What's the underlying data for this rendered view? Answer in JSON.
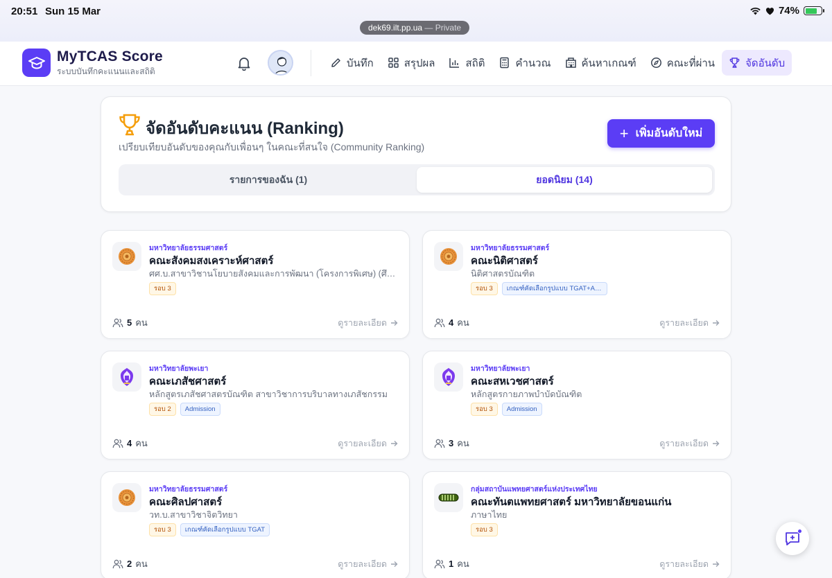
{
  "status_bar": {
    "time": "20:51",
    "date": "Sun 15 Mar",
    "battery": "74%",
    "battery_level": 0.74,
    "url": "dek69.ilt.pp.ua",
    "url_suffix": " — Private"
  },
  "header": {
    "brand": "MyTCAS Score",
    "tagline": "ระบบบันทึกคะแนนและสถิติ",
    "nav": [
      {
        "label": "บันทึก",
        "icon": "pen-icon"
      },
      {
        "label": "สรุปผล",
        "icon": "grid-icon"
      },
      {
        "label": "สถิติ",
        "icon": "bar-chart-icon"
      },
      {
        "label": "คำนวณ",
        "icon": "calculator-icon"
      },
      {
        "label": "ค้นหาเกณฑ์",
        "icon": "building-icon"
      },
      {
        "label": "คณะที่ผ่าน",
        "icon": "compass-icon"
      },
      {
        "label": "จัดอันดับ",
        "icon": "trophy-icon",
        "active": true
      }
    ]
  },
  "ranking": {
    "title": "จัดอันดับคะแนน (Ranking)",
    "subtitle": "เปรียบเทียบอันดับของคุณกับเพื่อนๆ ในคณะที่สนใจ (Community Ranking)",
    "add_button": "เพิ่มอันดับใหม่",
    "tabs": [
      "รายการของฉัน (1)",
      "ยอดนิยม (14)"
    ],
    "active_tab": 1
  },
  "cards": [
    {
      "university": "มหาวิทยาลัยธรรมศาสตร์",
      "faculty": "คณะสังคมสงเคราะห์ศาสตร์",
      "program": "ศศ.บ.สาขาวิชานโยบายสังคมและการพัฒนา (โครงการพิเศษ) (ศึกษาที่ ...",
      "tags": [
        "รอบ 3"
      ],
      "count": "5",
      "unit": "คน",
      "detail": "ดูรายละเอียด",
      "logo": "tu-logo"
    },
    {
      "university": "มหาวิทยาลัยธรรมศาสตร์",
      "faculty": "คณะนิติศาสตร์",
      "program": "นิติศาสตรบัณฑิต",
      "tags": [
        "รอบ 3",
        "เกณฑ์คัดเลือกรูปแบบ TGAT+A-le..."
      ],
      "count": "4",
      "unit": "คน",
      "detail": "ดูรายละเอียด",
      "logo": "tu-logo"
    },
    {
      "university": "มหาวิทยาลัยพะเยา",
      "faculty": "คณะเภสัชศาสตร์",
      "program": "หลักสูตรเภสัชศาสตรบัณฑิต สาขาวิชาการบริบาลทางเภสัชกรรม",
      "tags": [
        "รอบ 2",
        "Admission"
      ],
      "count": "4",
      "unit": "คน",
      "detail": "ดูรายละเอียด",
      "logo": "up-logo"
    },
    {
      "university": "มหาวิทยาลัยพะเยา",
      "faculty": "คณะสหเวชศาสตร์",
      "program": "หลักสูตรกายภาพบำบัดบัณฑิต",
      "tags": [
        "รอบ 3",
        "Admission"
      ],
      "count": "3",
      "unit": "คน",
      "detail": "ดูรายละเอียด",
      "logo": "up-logo"
    },
    {
      "university": "มหาวิทยาลัยธรรมศาสตร์",
      "faculty": "คณะศิลปศาสตร์",
      "program": "วท.บ.สาขาวิชาจิตวิทยา",
      "tags": [
        "รอบ 3",
        "เกณฑ์คัดเลือกรูปแบบ TGAT"
      ],
      "count": "2",
      "unit": "คน",
      "detail": "ดูรายละเอียด",
      "logo": "tu-logo"
    },
    {
      "university": "กลุ่มสถาบันแพทยศาสตร์แห่งประเทศไทย",
      "faculty": "คณะทันตแพทยศาสตร์ มหาวิทยาลัยขอนแก่น",
      "program": "ภาษาไทย",
      "tags": [
        "รอบ 3"
      ],
      "count": "1",
      "unit": "คน",
      "detail": "ดูรายละเอียด",
      "logo": "cotmes-logo"
    }
  ],
  "colors": {
    "accent": "#5b3df5",
    "round_tag": "#fff7e6",
    "criteria_tag": "#eef4ff"
  }
}
